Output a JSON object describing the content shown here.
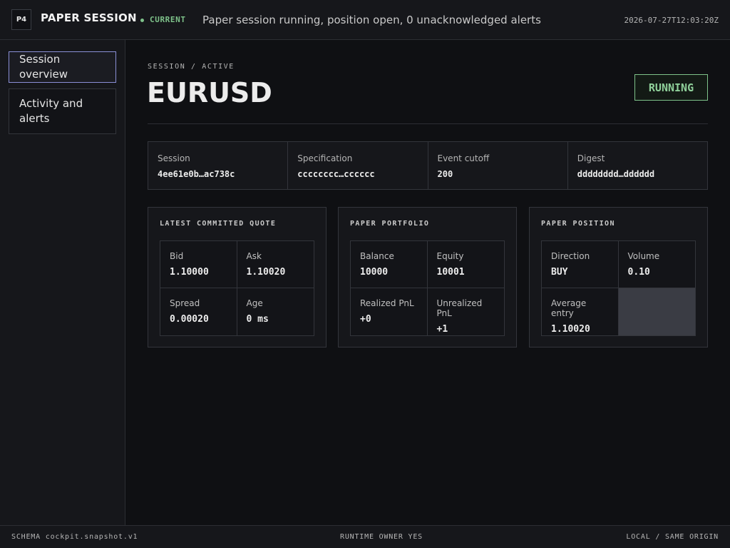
{
  "header": {
    "badge": "P4",
    "title": "PAPER SESSION",
    "current_label": "CURRENT",
    "status_summary": "Paper session running, position open, 0 unacknowledged alerts",
    "timestamp": "2026-07-27T12:03:20Z"
  },
  "sidebar": {
    "items": [
      {
        "label": "Session overview",
        "active": true
      },
      {
        "label": "Activity and alerts",
        "active": false
      }
    ]
  },
  "main": {
    "breadcrumb": "SESSION / ACTIVE",
    "symbol": "EURUSD",
    "state_badge": "RUNNING",
    "meta": [
      {
        "label": "Session",
        "value": "4ee61e0b…ac738c"
      },
      {
        "label": "Specification",
        "value": "cccccccc…cccccc"
      },
      {
        "label": "Event cutoff",
        "value": "200"
      },
      {
        "label": "Digest",
        "value": "dddddddd…dddddd"
      }
    ],
    "quote": {
      "title": "LATEST COMMITTED QUOTE",
      "cells": [
        {
          "label": "Bid",
          "value": "1.10000"
        },
        {
          "label": "Ask",
          "value": "1.10020"
        },
        {
          "label": "Spread",
          "value": "0.00020"
        },
        {
          "label": "Age",
          "value": "0 ms"
        }
      ]
    },
    "portfolio": {
      "title": "PAPER PORTFOLIO",
      "cells": [
        {
          "label": "Balance",
          "value": "10000"
        },
        {
          "label": "Equity",
          "value": "10001"
        },
        {
          "label": "Realized PnL",
          "value": "+0"
        },
        {
          "label": "Unrealized PnL",
          "value": "+1"
        }
      ]
    },
    "position": {
      "title": "PAPER POSITION",
      "cells": [
        {
          "label": "Direction",
          "value": "BUY"
        },
        {
          "label": "Volume",
          "value": "0.10"
        },
        {
          "label": "Average entry",
          "value": "1.10020"
        }
      ]
    }
  },
  "footer": {
    "left": "SCHEMA cockpit.snapshot.v1",
    "center": "RUNTIME OWNER YES",
    "right": "LOCAL / SAME ORIGIN"
  },
  "colors": {
    "accent_green": "#7ec28a",
    "active_nav_border": "#8a8fd6"
  }
}
